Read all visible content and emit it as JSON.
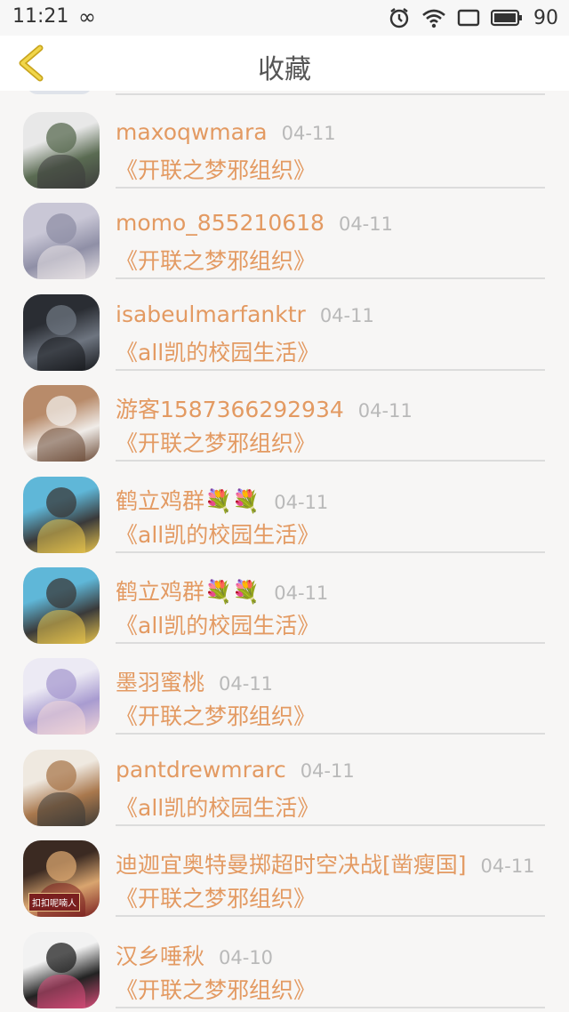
{
  "status_bar": {
    "time": "11:21",
    "battery": "90"
  },
  "header": {
    "title": "收藏"
  },
  "items": [
    {
      "user": "maxoqwmara",
      "date": "04-11",
      "book": "《开联之梦邪组织》",
      "avatar_colors": [
        "#e8e8e8",
        "#5a6b52",
        "#3c3c3c"
      ]
    },
    {
      "user": "momo_855210618",
      "date": "04-11",
      "book": "《开联之梦邪组织》",
      "avatar_colors": [
        "#c9c7d6",
        "#8f8fa6",
        "#e9e4e6"
      ]
    },
    {
      "user": "isabeulmarfanktr",
      "date": "04-11",
      "book": "《all凯的校园生活》",
      "avatar_colors": [
        "#2a2d33",
        "#6e7580",
        "#16181c"
      ]
    },
    {
      "user": "游客1587366292934",
      "date": "04-11",
      "book": "《开联之梦邪组织》",
      "avatar_colors": [
        "#b88b6a",
        "#f0ece8",
        "#6b4a36"
      ]
    },
    {
      "user": "鹤立鸡群💐💐",
      "date": "04-11",
      "book": "《all凯的校园生活》",
      "avatar_colors": [
        "#5fb7d8",
        "#3a3a3a",
        "#e8c44c"
      ]
    },
    {
      "user": "鹤立鸡群💐💐",
      "date": "04-11",
      "book": "《all凯的校园生活》",
      "avatar_colors": [
        "#5fb7d8",
        "#3a3a3a",
        "#e8c44c"
      ]
    },
    {
      "user": "墨羽蜜桃",
      "date": "04-11",
      "book": "《开联之梦邪组织》",
      "avatar_colors": [
        "#eceaf4",
        "#a89bd0",
        "#f3d7d9"
      ]
    },
    {
      "user": "pantdrewmrarc",
      "date": "04-11",
      "book": "《all凯的校园生活》",
      "avatar_colors": [
        "#efe9e0",
        "#a9784d",
        "#3c3a36"
      ]
    },
    {
      "user": "迪迦宜奥特曼掷超时空决战[凿瘦国]",
      "date": "04-11",
      "book": "《开联之梦邪组织》",
      "avatar_colors": [
        "#3b2a22",
        "#d9a56f",
        "#7a1f1f"
      ],
      "avatar_badge": "扣扣呢喃人"
    },
    {
      "user": "汉乡唾秋",
      "date": "04-10",
      "book": "《开联之梦邪组织》",
      "avatar_colors": [
        "#f2f2f2",
        "#222222",
        "#d94d7a"
      ]
    }
  ]
}
